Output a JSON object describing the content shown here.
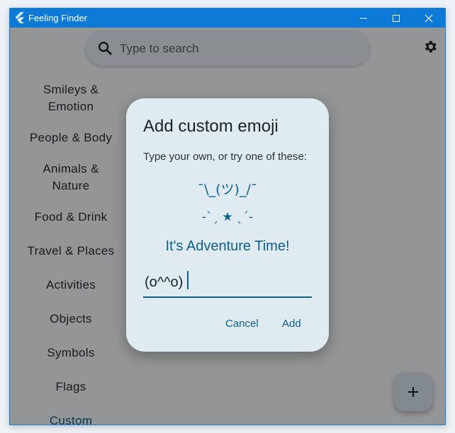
{
  "window": {
    "title": "Feeling Finder",
    "accent_color": "#0c7ad6"
  },
  "search": {
    "placeholder": "Type to search",
    "icon": "search-icon"
  },
  "settings": {
    "icon": "gear-icon"
  },
  "sidebar": {
    "items": [
      {
        "line1": "Smileys &",
        "line2": "Emotion"
      },
      {
        "line1": "People & Body"
      },
      {
        "line1": "Animals &",
        "line2": "Nature"
      },
      {
        "line1": "Food & Drink"
      },
      {
        "line1": "Travel & Places"
      },
      {
        "line1": "Activities"
      },
      {
        "line1": "Objects"
      },
      {
        "line1": "Symbols"
      },
      {
        "line1": "Flags"
      },
      {
        "line1": "Custom",
        "active": true
      }
    ]
  },
  "fab": {
    "label": "+",
    "icon": "add-icon"
  },
  "dialog": {
    "title": "Add custom emoji",
    "subtitle": "Type your own, or try one of these:",
    "suggestions": [
      "¯\\_(ツ)_/¯",
      "-ˋˏ ★ ˎˊ-",
      "It's Adventure Time!"
    ],
    "input_value": "(o^^o)",
    "cancel_label": "Cancel",
    "add_label": "Add",
    "accent_color": "#0f5f8b"
  }
}
